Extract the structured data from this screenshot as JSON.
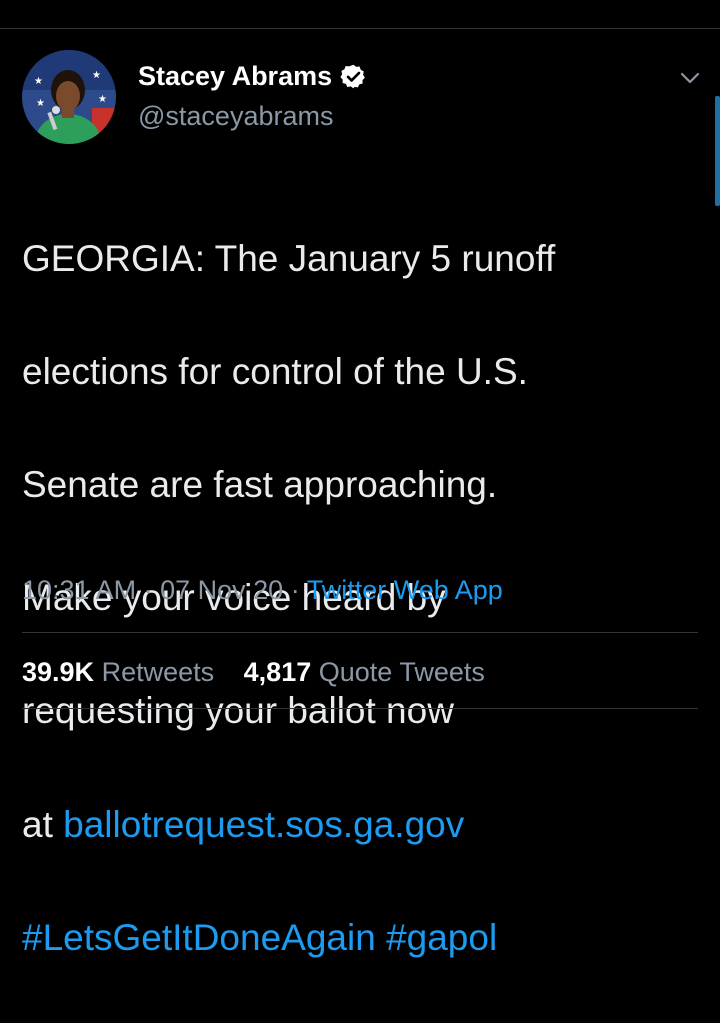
{
  "author": {
    "display_name": "Stacey Abrams",
    "handle": "@staceyabrams",
    "verified": true
  },
  "tweet": {
    "lines": [
      "GEORGIA: The January 5 runoff",
      "elections for control of the U.S.",
      "Senate are fast approaching.",
      "Make your voice heard by",
      "requesting your ballot now"
    ],
    "link_prefix": "at ",
    "link": "ballotrequest.sos.ga.gov",
    "hashtag1": "#LetsGetItDoneAgain",
    "hashtag2": "#gapol"
  },
  "meta": {
    "time": "10:31 AM",
    "separator": "·",
    "date": "07 Nov 20",
    "source": "Twitter Web App"
  },
  "stats": {
    "retweets_count": "39.9K",
    "retweets_label": "Retweets",
    "quote_count": "4,817",
    "quote_label": "Quote Tweets"
  },
  "colors": {
    "background": "#000000",
    "link": "#1d9bf0",
    "secondary_text": "#8b98a5",
    "divider": "#2f3336"
  },
  "icons": {
    "verified": "verified-badge-icon",
    "more": "chevron-down-icon"
  }
}
